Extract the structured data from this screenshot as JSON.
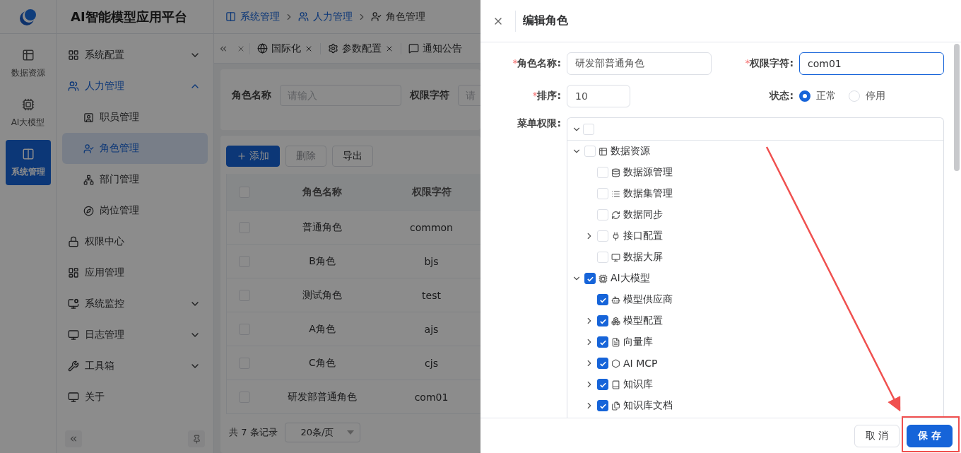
{
  "app": {
    "title": "AI智能模型应用平台"
  },
  "breadcrumb": [
    {
      "label": "系统管理",
      "current": false
    },
    {
      "label": "人力管理",
      "current": false
    },
    {
      "label": "角色管理",
      "current": true
    }
  ],
  "rail": [
    {
      "label": "数据资源",
      "selected": false
    },
    {
      "label": "AI大模型",
      "selected": false
    },
    {
      "label": "系统管理",
      "selected": true
    }
  ],
  "sidebar": {
    "items": [
      {
        "label": "系统配置",
        "expanded": false,
        "selected": false
      },
      {
        "label": "人力管理",
        "expanded": true,
        "selected": true,
        "children": [
          {
            "label": "职员管理",
            "selected": false
          },
          {
            "label": "角色管理",
            "selected": true
          },
          {
            "label": "部门管理",
            "selected": false
          },
          {
            "label": "岗位管理",
            "selected": false
          }
        ]
      },
      {
        "label": "权限中心",
        "selected": false
      },
      {
        "label": "应用管理",
        "selected": false
      },
      {
        "label": "系统监控",
        "expanded": false,
        "selected": false
      },
      {
        "label": "日志管理",
        "expanded": false,
        "selected": false
      },
      {
        "label": "工具箱",
        "expanded": false,
        "selected": false
      },
      {
        "label": "关于",
        "selected": false
      }
    ]
  },
  "tabs": [
    {
      "label": "国际化",
      "closable": true
    },
    {
      "label": "参数配置",
      "closable": true
    },
    {
      "label": "通知公告",
      "closable": false
    }
  ],
  "search": {
    "fields": [
      {
        "label": "角色名称",
        "placeholder": "请输入"
      },
      {
        "label": "权限字符",
        "placeholder": "请"
      }
    ]
  },
  "toolbar": [
    {
      "label": "添加",
      "kind": "primary",
      "disabled": false
    },
    {
      "label": "删除",
      "kind": "default",
      "disabled": true
    },
    {
      "label": "导出",
      "kind": "default",
      "disabled": false
    }
  ],
  "table": {
    "all_selected": false,
    "columns": [
      "角色名称",
      "权限字符"
    ],
    "rows": [
      {
        "selected": false,
        "cells": [
          "普通角色",
          "common"
        ]
      },
      {
        "selected": false,
        "cells": [
          "B角色",
          "bjs"
        ]
      },
      {
        "selected": false,
        "cells": [
          "测试角色",
          "test"
        ]
      },
      {
        "selected": false,
        "cells": [
          "A角色",
          "ajs"
        ]
      },
      {
        "selected": false,
        "cells": [
          "C角色",
          "cjs"
        ]
      },
      {
        "selected": false,
        "cells": [
          "研发部普通角色",
          "com01"
        ]
      }
    ]
  },
  "pagination": {
    "total": "共 7 条记录",
    "page_size": "20条/页"
  },
  "drawer": {
    "title": "编辑角色",
    "fields": [
      {
        "label": "角色名称:",
        "required_mark": "*",
        "value": "研发部普通角色",
        "focused": false
      },
      {
        "label": "权限字符:",
        "required_mark": "*",
        "value": "com01",
        "focused": true
      },
      {
        "label": "排序:",
        "required_mark": "*",
        "value": "10",
        "focused": false
      }
    ],
    "status": {
      "label": "状态:",
      "options": [
        {
          "label": "正常",
          "selected": true
        },
        {
          "label": "停用",
          "selected": false
        }
      ]
    },
    "menu_label": "菜单权限:",
    "tree": {
      "root": {
        "checked": false,
        "expanded": true
      },
      "nodes": [
        {
          "label": "数据资源",
          "checked": false,
          "expanded": true,
          "children": [
            {
              "label": "数据源管理",
              "checked": false
            },
            {
              "label": "数据集管理",
              "checked": false
            },
            {
              "label": "数据同步",
              "checked": false
            },
            {
              "label": "接口配置",
              "checked": false,
              "expanded": false
            },
            {
              "label": "数据大屏",
              "checked": false
            }
          ]
        },
        {
          "label": "AI大模型",
          "checked": true,
          "expanded": true,
          "children": [
            {
              "label": "模型供应商",
              "checked": true
            },
            {
              "label": "模型配置",
              "checked": true,
              "expanded": false
            },
            {
              "label": "向量库",
              "checked": true,
              "expanded": false
            },
            {
              "label": "AI MCP",
              "checked": true,
              "expanded": false
            },
            {
              "label": "知识库",
              "checked": true,
              "expanded": false
            },
            {
              "label": "知识库文档",
              "checked": true,
              "expanded": false
            }
          ]
        }
      ]
    },
    "buttons": [
      {
        "label": "取 消",
        "kind": "default"
      },
      {
        "label": "保 存",
        "kind": "primary"
      }
    ]
  }
}
